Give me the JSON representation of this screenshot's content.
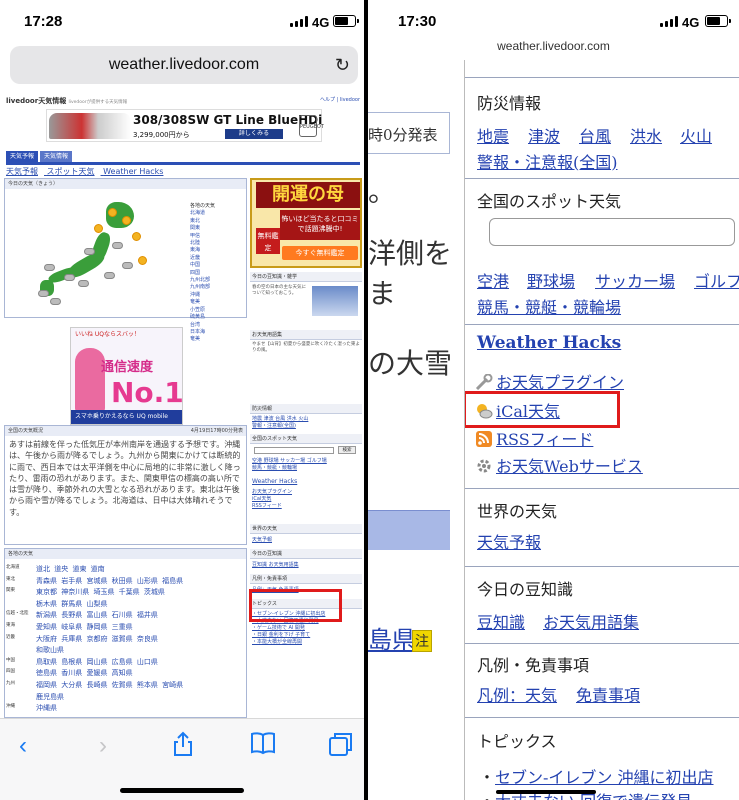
{
  "left": {
    "status": {
      "time": "17:28",
      "network": "4G"
    },
    "url": "weather.livedoor.com",
    "site": {
      "logo": "livedoor天気情報",
      "tagline": "livedoorが提供する天気情報",
      "header_links": "ヘルプ | livedoor"
    },
    "car_ad": {
      "model": "308/308SW GT Line BlueHDi",
      "price": "3,299,000円から",
      "button": "詳しくみる",
      "brand": "PEUGEOT"
    },
    "tabs": [
      "天気予報",
      "天気情報"
    ],
    "nav": [
      "天気予報",
      "スポット天気",
      "Weather Hacks"
    ],
    "today_header": "今日の天気（きょう）",
    "regions_header": "各地の天気",
    "regions": [
      "北海道",
      "東北",
      "関東",
      "甲信",
      "北陸",
      "東海",
      "近畿",
      "中国",
      "四国",
      "九州北部",
      "九州南部",
      "沖縄",
      "奄美",
      "小笠原",
      "硫黄島",
      "台湾",
      "日本海",
      "奄美"
    ],
    "uq_ad": {
      "top": "いいね UQならスバッ！",
      "line1": "通信速度",
      "line2": "No.1",
      "bottom": "スマホ乗りかえるなら UQ mobile"
    },
    "forecast_header": "全国の天気概況",
    "forecast_date": "4月19日17時00分発表",
    "forecast_text": "あすは前線を伴った低気圧が本州南岸を通過する予想です。沖縄は、午後から雨が降るでしょう。九州から関東にかけては断続的に雨で、西日本では太平洋側を中心に局地的に非常に激しく降ったり、雷雨の恐れがあります。また、関東甲信の標高の高い所では雪が降り、季節外れの大雪となる恐れがあります。東北は午後から雨や雪が降るでしょう。北海道は、日中は大体晴れそうです。",
    "pref_header": "各地の天気",
    "pref_rows": [
      {
        "label": "北海道",
        "items": "道北 道央 道東 道南"
      },
      {
        "label": "東北",
        "items": "青森県 岩手県 宮城県 秋田県 山形県 福島県"
      },
      {
        "label": "関東",
        "items": "東京都 神奈川県 埼玉県 千葉県 茨城県"
      },
      {
        "label": "",
        "items": "栃木県 群馬県 山梨県"
      },
      {
        "label": "信越・北陸",
        "items": "新潟県 長野県 富山県 石川県 福井県"
      },
      {
        "label": "東海",
        "items": "愛知県 岐阜県 静岡県 三重県"
      },
      {
        "label": "近畿",
        "items": "大阪府 兵庫県 京都府 滋賀県 奈良県"
      },
      {
        "label": "",
        "items": "和歌山県"
      },
      {
        "label": "中国",
        "items": "鳥取県 島根県 岡山県 広島県 山口県"
      },
      {
        "label": "四国",
        "items": "徳島県 香川県 愛媛県 高知県"
      },
      {
        "label": "九州",
        "items": "福岡県 大分県 長崎県 佐賀県 熊本県 宮崎県"
      },
      {
        "label": "",
        "items": "鹿児島県"
      },
      {
        "label": "沖縄",
        "items": "沖縄県"
      }
    ],
    "haha_ad": {
      "title": "開運の母",
      "sub": "怖いほど当たると口コミで話題沸騰中!",
      "badge": "無料鑑定",
      "button": "今すぐ無料鑑定"
    },
    "side": {
      "trivia_header": "今日の豆知識・雑学",
      "term_header": "お天気用語集",
      "disaster_header": "防災情報",
      "spot_header": "全国のスポット天気",
      "search_btn": "検索",
      "hacks": "Weather Hacks",
      "plugin": "お天気プラグイン",
      "ical": "iCal天気",
      "rss": "RSSフィード",
      "world_header": "世界の天気",
      "world_link": "天気予報",
      "today_header": "今日の豆知識",
      "legend_header": "凡例・免責事項",
      "topics_header": "トピックス"
    }
  },
  "right": {
    "status": {
      "time": "17:30",
      "network": "4G"
    },
    "url": "weather.livedoor.com",
    "cut_texts": [
      "時0分発表",
      "。",
      "洋側を",
      "ま",
      "の大雪",
      "島県",
      "注"
    ],
    "disaster": {
      "title": "防災情報",
      "links": [
        "地震",
        "津波",
        "台風",
        "洪水",
        "火山"
      ],
      "links2": [
        "警報・注意報(全国)"
      ]
    },
    "spot": {
      "title": "全国のスポット天気",
      "links": [
        "空港",
        "野球場",
        "サッカー場",
        "ゴルフ"
      ],
      "links2": [
        "競馬・競艇・競輪場"
      ]
    },
    "hacks": {
      "title": "Weather Hacks",
      "items": [
        "お天気プラグイン",
        "iCal天気",
        "RSSフィード",
        "お天気Webサービス"
      ]
    },
    "world": {
      "title": "世界の天気",
      "link": "天気予報"
    },
    "trivia": {
      "title": "今日の豆知識",
      "links": [
        "豆知識",
        "お天気用語集"
      ]
    },
    "legend": {
      "title": "凡例・免責事項",
      "links": [
        "凡例：天気",
        "免責事項"
      ]
    },
    "topics": {
      "title": "トピックス",
      "items": [
        "セブン-イレブン 沖縄に初出店",
        "大丈夫ない 回復で遺伝発見"
      ]
    }
  }
}
